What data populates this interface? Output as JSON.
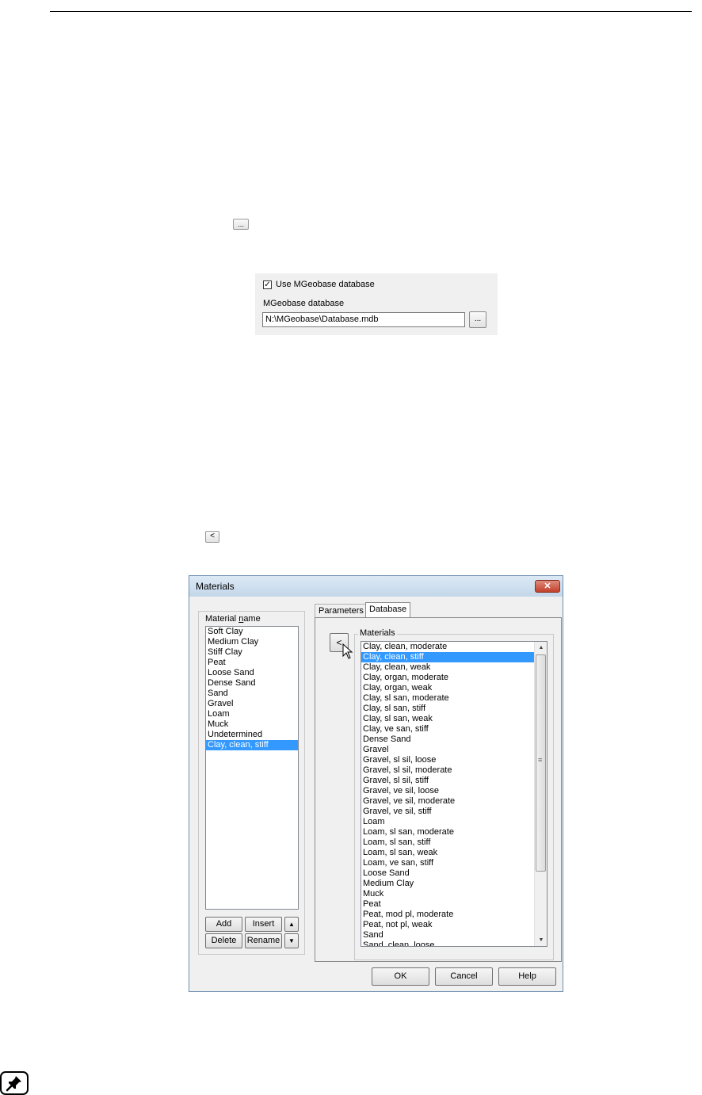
{
  "inline_buttons": {
    "browse_small_label": "...",
    "back_small_label": "<"
  },
  "db_panel": {
    "checkbox_checked": true,
    "checkbox_mark": "✓",
    "checkbox_label": "Use MGeobase database",
    "field_label": "MGeobase database",
    "field_value": "N:\\MGeobase\\Database.mdb",
    "browse_label": "..."
  },
  "dialog": {
    "title": "Materials",
    "close_symbol": "✕",
    "left_group_label": "Material name",
    "material_names": [
      "Soft Clay",
      "Medium Clay",
      "Stiff Clay",
      "Peat",
      "Loose Sand",
      "Dense Sand",
      "Sand",
      "Gravel",
      "Loam",
      "Muck",
      "Undetermined",
      "Clay, clean, stiff"
    ],
    "selected_material": "Clay, clean, stiff",
    "buttons": {
      "add": "Add",
      "insert": "Insert",
      "delete": "Delete",
      "rename": "Rename",
      "up": "▲",
      "down": "▼"
    },
    "tabs": [
      {
        "label": "Parameters"
      },
      {
        "label": "Database"
      }
    ],
    "active_tab": "Database",
    "copy_button_label": "<",
    "database_group_label": "Materials",
    "database_materials": [
      "Clay, clean, moderate",
      "Clay, clean, stiff",
      "Clay, clean, weak",
      "Clay, organ, moderate",
      "Clay, organ, weak",
      "Clay, sl san, moderate",
      "Clay, sl san, stiff",
      "Clay, sl san, weak",
      "Clay, ve san, stiff",
      "Dense Sand",
      "Gravel",
      "Gravel, sl sil, loose",
      "Gravel, sl sil, moderate",
      "Gravel, sl sil, stiff",
      "Gravel, ve sil, loose",
      "Gravel, ve sil, moderate",
      "Gravel, ve sil, stiff",
      "Loam",
      "Loam, sl san, moderate",
      "Loam, sl san, stiff",
      "Loam, sl san, weak",
      "Loam, ve san, stiff",
      "Loose Sand",
      "Medium Clay",
      "Muck",
      "Peat",
      "Peat, mod pl, moderate",
      "Peat, not pl, weak",
      "Sand",
      "Sand, clean, loose"
    ],
    "selected_database_material": "Clay, clean, stiff",
    "footer": {
      "ok": "OK",
      "cancel": "Cancel",
      "help": "Help"
    },
    "scroll": {
      "up": "▲",
      "down": "▼",
      "grip": "≡"
    }
  },
  "note_icon": "pushpin-icon"
}
